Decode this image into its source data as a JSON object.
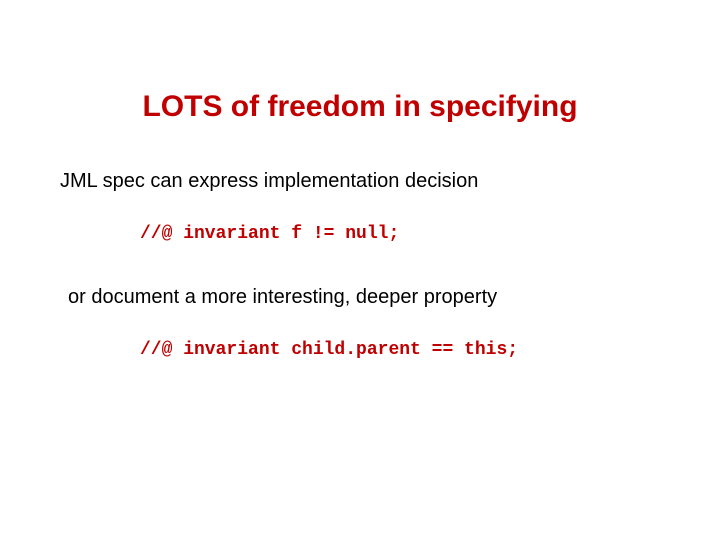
{
  "title": "LOTS of freedom in specifying",
  "line1": "JML spec can express implementation decision",
  "code1": "//@ invariant f != null;",
  "line2": "or document a more interesting, deeper property",
  "code2": "//@ invariant child.parent == this;"
}
